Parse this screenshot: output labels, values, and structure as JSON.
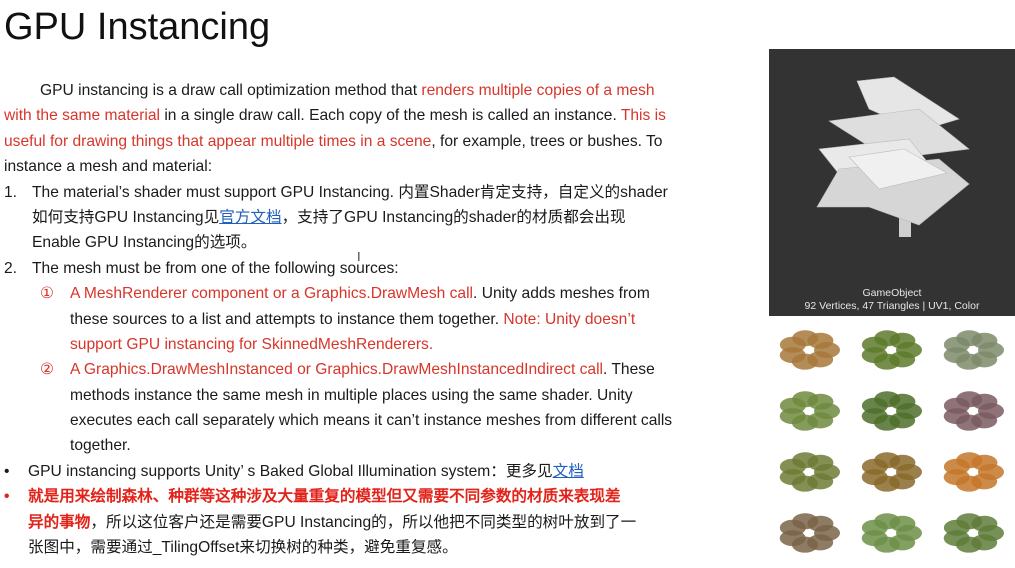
{
  "title": "GPU Instancing",
  "colors": {
    "red": "#d8352a",
    "bold_red": "#e2231a",
    "link": "#1f5fbf",
    "preview_bg": "#333333"
  },
  "lines": [
    {
      "indent": 40,
      "segments": [
        {
          "t": "GPU instancing is a draw call optimization method that "
        },
        {
          "t": "renders multiple copies of a mesh",
          "s": "red"
        }
      ]
    },
    {
      "indent": 4,
      "segments": [
        {
          "t": "with the same material",
          "s": "red"
        },
        {
          "t": " in a single draw call. Each copy of the mesh is called an instance. "
        },
        {
          "t": "This is",
          "s": "red"
        }
      ]
    },
    {
      "indent": 4,
      "segments": [
        {
          "t": "useful for drawing things that appear multiple times in a scene",
          "s": "red"
        },
        {
          "t": ", for example, trees or bushes. To"
        }
      ]
    },
    {
      "indent": 4,
      "segments": [
        {
          "t": "instance a mesh and material:"
        }
      ]
    },
    {
      "indent": 32,
      "marker": "1.",
      "segments": [
        {
          "t": "The material’s shader must support GPU Instancing. 内置Shader肯定支持，自定义的shader"
        }
      ]
    },
    {
      "indent": 32,
      "segments": [
        {
          "t": "如何支持GPU Instancing见"
        },
        {
          "t": "官方文档",
          "s": "link"
        },
        {
          "t": "，支持了GPU Instancing的shader的材质都会出现"
        }
      ]
    },
    {
      "indent": 32,
      "segments": [
        {
          "t": "Enable GPU Instancing的选项。"
        }
      ]
    },
    {
      "indent": 32,
      "marker": "2.",
      "segments": [
        {
          "t": "The mesh must be from one of the following sources:"
        }
      ]
    },
    {
      "indent": 70,
      "marker": "①",
      "marker_style": "red",
      "segments": [
        {
          "t": "A MeshRenderer component or a Graphics.DrawMesh call",
          "s": "red"
        },
        {
          "t": ". Unity adds meshes from"
        }
      ]
    },
    {
      "indent": 70,
      "segments": [
        {
          "t": "these sources to a list and attempts to instance them together. "
        },
        {
          "t": "Note: Unity doesn’t",
          "s": "red"
        }
      ]
    },
    {
      "indent": 70,
      "segments": [
        {
          "t": "support GPU instancing for SkinnedMeshRenderers.",
          "s": "red"
        }
      ]
    },
    {
      "indent": 70,
      "marker": "②",
      "marker_style": "red",
      "segments": [
        {
          "t": "A Graphics.DrawMeshInstanced or Graphics.DrawMeshInstancedIndirect call",
          "s": "red"
        },
        {
          "t": ". These"
        }
      ]
    },
    {
      "indent": 70,
      "segments": [
        {
          "t": "methods instance the same mesh in multiple places using the same shader. Unity"
        }
      ]
    },
    {
      "indent": 70,
      "segments": [
        {
          "t": "executes each call separately which means it can’t instance meshes from different calls"
        }
      ]
    },
    {
      "indent": 70,
      "segments": [
        {
          "t": "together."
        }
      ]
    },
    {
      "indent": 28,
      "marker": "•",
      "segments": [
        {
          "t": "GPU instancing supports Unity’ s Baked Global Illumination system：更多见"
        },
        {
          "t": "文档",
          "s": "link"
        }
      ]
    },
    {
      "indent": 28,
      "marker": "•",
      "marker_style": "bred",
      "segments": [
        {
          "t": "就是用来绘制森林、种群等这种涉及大量重复的模型但又需要不同参数的材质来表现差",
          "s": "bred"
        }
      ]
    },
    {
      "indent": 28,
      "segments": [
        {
          "t": "异的事物",
          "s": "bred"
        },
        {
          "t": "，所以这位客户还是需要GPU Instancing的，所以他把不同类型的树叶放到了一"
        }
      ]
    },
    {
      "indent": 28,
      "segments": [
        {
          "t": "张图中，需要通过_TilingOffset来切换树的种类，避免重复感。"
        }
      ]
    }
  ],
  "preview": {
    "name": "GameObject",
    "stats": "92 Vertices, 47 Triangles | UV1, Color"
  },
  "atlas": {
    "cells": [
      "#a7783a",
      "#5d7a2c",
      "#7d8a6a",
      "#6f8a3e",
      "#4f6e2a",
      "#7a5a60",
      "#6d7b35",
      "#8a6a2c",
      "#c4772a",
      "#7a6448",
      "#6d8f48",
      "#5f7d3a"
    ]
  }
}
